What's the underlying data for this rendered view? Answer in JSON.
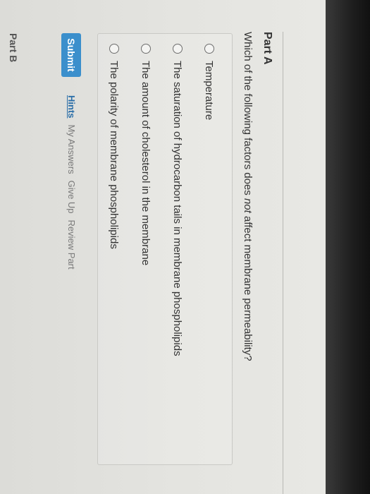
{
  "part_a": {
    "title": "Part A",
    "question_before": "Which of the following factors does ",
    "question_em": "not",
    "question_after": " affect membrane permeability?",
    "options": [
      {
        "label": "Temperature"
      },
      {
        "label": "The saturation of hydrocarbon tails in membrane phospholipids"
      },
      {
        "label": "The amount of cholesterol in the membrane"
      },
      {
        "label": "The polarity of membrane phospholipids"
      }
    ]
  },
  "actions": {
    "submit_label": "Submit",
    "hints_label": "Hints",
    "my_answers_label": "My Answers",
    "give_up_label": "Give Up",
    "review_part_label": "Review Part"
  },
  "part_b": {
    "title": "Part B"
  },
  "colors": {
    "submit_button": "#3b8fcc",
    "hints_link": "#2a6ea8"
  }
}
